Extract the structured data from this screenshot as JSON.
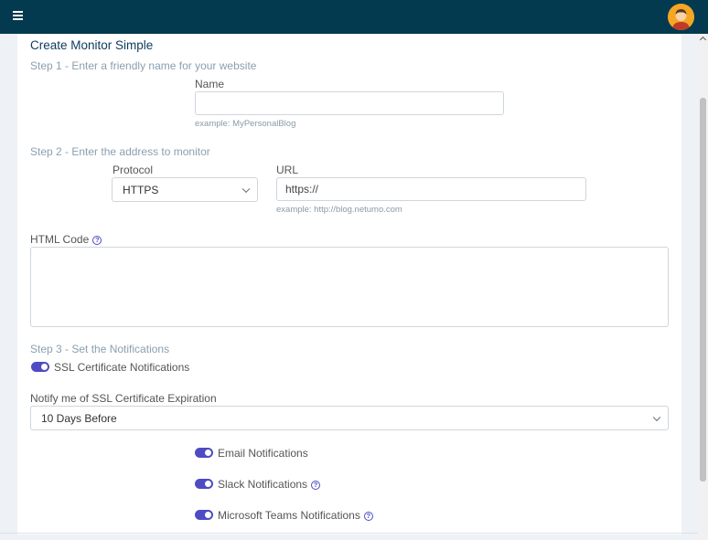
{
  "header": {
    "menu_icon": "hamburger-icon",
    "avatar_icon": "user-avatar"
  },
  "title": "Create Monitor Simple",
  "step1": {
    "title": "Step 1 - Enter a friendly name for your website",
    "name_label": "Name",
    "name_value": "",
    "name_hint": "example: MyPersonalBlog"
  },
  "step2": {
    "title": "Step 2 - Enter the address to monitor",
    "protocol_label": "Protocol",
    "protocol_value": "HTTPS",
    "url_label": "URL",
    "url_value": "https://",
    "url_hint": "example: http://blog.netumo.com"
  },
  "html_code": {
    "label": "HTML Code",
    "value": ""
  },
  "step3": {
    "title": "Step 3 - Set the Notifications",
    "ssl_toggle": {
      "label": "SSL Certificate Notifications",
      "on": true
    },
    "expiry_label": "Notify me of SSL Certificate Expiration",
    "expiry_value": "10 Days Before",
    "toggles": [
      {
        "label": "Email Notifications",
        "on": true
      },
      {
        "label": "Slack Notifications",
        "on": true
      },
      {
        "label": "Microsoft Teams Notifications",
        "on": true
      }
    ]
  },
  "colors": {
    "header": "#033a4f",
    "accent": "#4e4bc3",
    "title": "#0c3b5d"
  }
}
